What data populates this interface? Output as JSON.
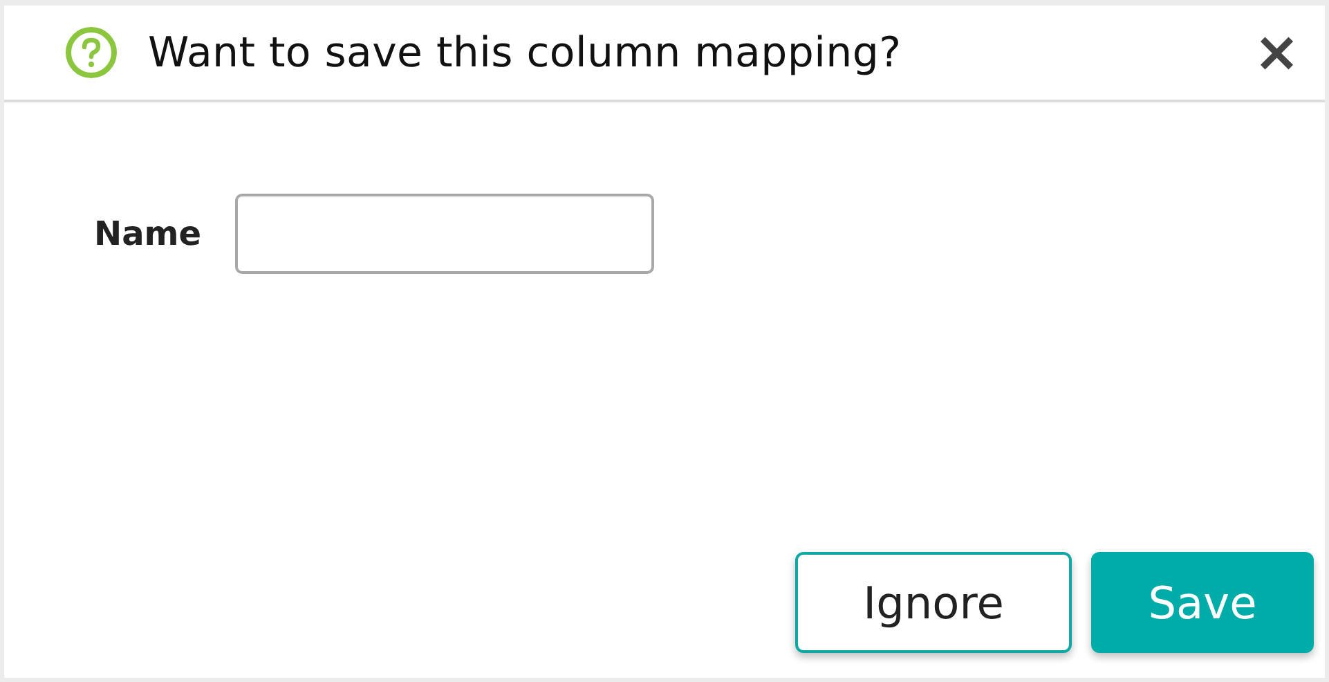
{
  "dialog": {
    "title": "Want to save this column mapping?",
    "close": "×"
  },
  "form": {
    "label": "Name"
  },
  "buttons": [
    {
      "label": "Ignore",
      "kind": "secondary"
    },
    {
      "label": "Save",
      "kind": "primary"
    }
  ]
}
